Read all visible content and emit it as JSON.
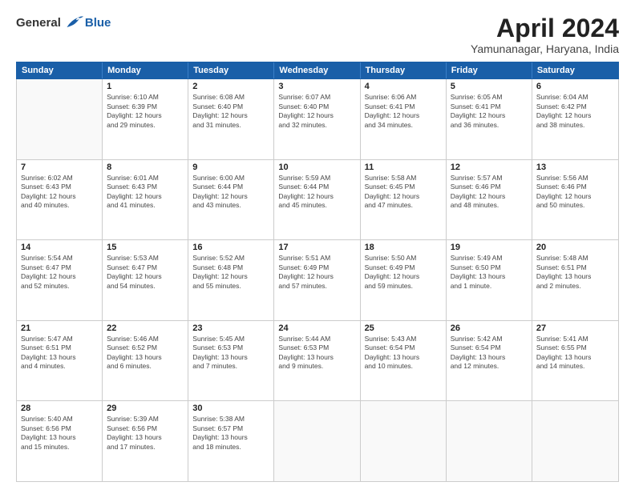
{
  "logo": {
    "general": "General",
    "blue": "Blue"
  },
  "title": "April 2024",
  "location": "Yamunanagar, Haryana, India",
  "header_days": [
    "Sunday",
    "Monday",
    "Tuesday",
    "Wednesday",
    "Thursday",
    "Friday",
    "Saturday"
  ],
  "rows": [
    [
      {
        "day": "",
        "empty": true
      },
      {
        "day": "1",
        "lines": [
          "Sunrise: 6:10 AM",
          "Sunset: 6:39 PM",
          "Daylight: 12 hours",
          "and 29 minutes."
        ]
      },
      {
        "day": "2",
        "lines": [
          "Sunrise: 6:08 AM",
          "Sunset: 6:40 PM",
          "Daylight: 12 hours",
          "and 31 minutes."
        ]
      },
      {
        "day": "3",
        "lines": [
          "Sunrise: 6:07 AM",
          "Sunset: 6:40 PM",
          "Daylight: 12 hours",
          "and 32 minutes."
        ]
      },
      {
        "day": "4",
        "lines": [
          "Sunrise: 6:06 AM",
          "Sunset: 6:41 PM",
          "Daylight: 12 hours",
          "and 34 minutes."
        ]
      },
      {
        "day": "5",
        "lines": [
          "Sunrise: 6:05 AM",
          "Sunset: 6:41 PM",
          "Daylight: 12 hours",
          "and 36 minutes."
        ]
      },
      {
        "day": "6",
        "lines": [
          "Sunrise: 6:04 AM",
          "Sunset: 6:42 PM",
          "Daylight: 12 hours",
          "and 38 minutes."
        ]
      }
    ],
    [
      {
        "day": "7",
        "lines": [
          "Sunrise: 6:02 AM",
          "Sunset: 6:43 PM",
          "Daylight: 12 hours",
          "and 40 minutes."
        ]
      },
      {
        "day": "8",
        "lines": [
          "Sunrise: 6:01 AM",
          "Sunset: 6:43 PM",
          "Daylight: 12 hours",
          "and 41 minutes."
        ]
      },
      {
        "day": "9",
        "lines": [
          "Sunrise: 6:00 AM",
          "Sunset: 6:44 PM",
          "Daylight: 12 hours",
          "and 43 minutes."
        ]
      },
      {
        "day": "10",
        "lines": [
          "Sunrise: 5:59 AM",
          "Sunset: 6:44 PM",
          "Daylight: 12 hours",
          "and 45 minutes."
        ]
      },
      {
        "day": "11",
        "lines": [
          "Sunrise: 5:58 AM",
          "Sunset: 6:45 PM",
          "Daylight: 12 hours",
          "and 47 minutes."
        ]
      },
      {
        "day": "12",
        "lines": [
          "Sunrise: 5:57 AM",
          "Sunset: 6:46 PM",
          "Daylight: 12 hours",
          "and 48 minutes."
        ]
      },
      {
        "day": "13",
        "lines": [
          "Sunrise: 5:56 AM",
          "Sunset: 6:46 PM",
          "Daylight: 12 hours",
          "and 50 minutes."
        ]
      }
    ],
    [
      {
        "day": "14",
        "lines": [
          "Sunrise: 5:54 AM",
          "Sunset: 6:47 PM",
          "Daylight: 12 hours",
          "and 52 minutes."
        ]
      },
      {
        "day": "15",
        "lines": [
          "Sunrise: 5:53 AM",
          "Sunset: 6:47 PM",
          "Daylight: 12 hours",
          "and 54 minutes."
        ]
      },
      {
        "day": "16",
        "lines": [
          "Sunrise: 5:52 AM",
          "Sunset: 6:48 PM",
          "Daylight: 12 hours",
          "and 55 minutes."
        ]
      },
      {
        "day": "17",
        "lines": [
          "Sunrise: 5:51 AM",
          "Sunset: 6:49 PM",
          "Daylight: 12 hours",
          "and 57 minutes."
        ]
      },
      {
        "day": "18",
        "lines": [
          "Sunrise: 5:50 AM",
          "Sunset: 6:49 PM",
          "Daylight: 12 hours",
          "and 59 minutes."
        ]
      },
      {
        "day": "19",
        "lines": [
          "Sunrise: 5:49 AM",
          "Sunset: 6:50 PM",
          "Daylight: 13 hours",
          "and 1 minute."
        ]
      },
      {
        "day": "20",
        "lines": [
          "Sunrise: 5:48 AM",
          "Sunset: 6:51 PM",
          "Daylight: 13 hours",
          "and 2 minutes."
        ]
      }
    ],
    [
      {
        "day": "21",
        "lines": [
          "Sunrise: 5:47 AM",
          "Sunset: 6:51 PM",
          "Daylight: 13 hours",
          "and 4 minutes."
        ]
      },
      {
        "day": "22",
        "lines": [
          "Sunrise: 5:46 AM",
          "Sunset: 6:52 PM",
          "Daylight: 13 hours",
          "and 6 minutes."
        ]
      },
      {
        "day": "23",
        "lines": [
          "Sunrise: 5:45 AM",
          "Sunset: 6:53 PM",
          "Daylight: 13 hours",
          "and 7 minutes."
        ]
      },
      {
        "day": "24",
        "lines": [
          "Sunrise: 5:44 AM",
          "Sunset: 6:53 PM",
          "Daylight: 13 hours",
          "and 9 minutes."
        ]
      },
      {
        "day": "25",
        "lines": [
          "Sunrise: 5:43 AM",
          "Sunset: 6:54 PM",
          "Daylight: 13 hours",
          "and 10 minutes."
        ]
      },
      {
        "day": "26",
        "lines": [
          "Sunrise: 5:42 AM",
          "Sunset: 6:54 PM",
          "Daylight: 13 hours",
          "and 12 minutes."
        ]
      },
      {
        "day": "27",
        "lines": [
          "Sunrise: 5:41 AM",
          "Sunset: 6:55 PM",
          "Daylight: 13 hours",
          "and 14 minutes."
        ]
      }
    ],
    [
      {
        "day": "28",
        "lines": [
          "Sunrise: 5:40 AM",
          "Sunset: 6:56 PM",
          "Daylight: 13 hours",
          "and 15 minutes."
        ]
      },
      {
        "day": "29",
        "lines": [
          "Sunrise: 5:39 AM",
          "Sunset: 6:56 PM",
          "Daylight: 13 hours",
          "and 17 minutes."
        ]
      },
      {
        "day": "30",
        "lines": [
          "Sunrise: 5:38 AM",
          "Sunset: 6:57 PM",
          "Daylight: 13 hours",
          "and 18 minutes."
        ]
      },
      {
        "day": "",
        "empty": true
      },
      {
        "day": "",
        "empty": true
      },
      {
        "day": "",
        "empty": true
      },
      {
        "day": "",
        "empty": true
      }
    ]
  ]
}
